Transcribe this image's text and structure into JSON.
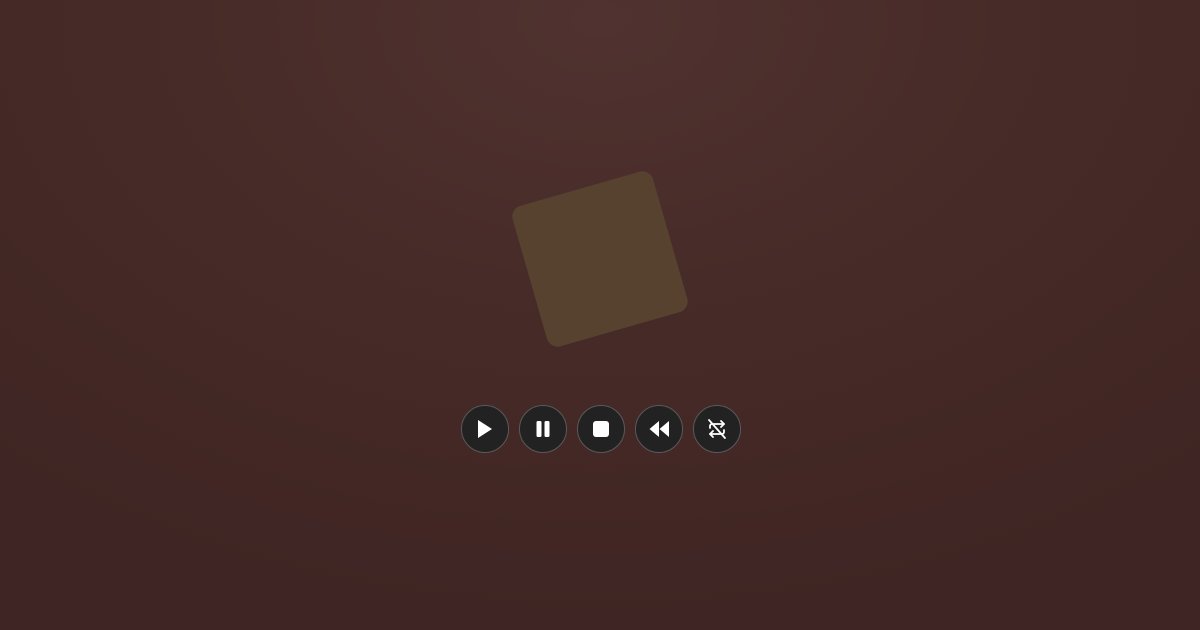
{
  "colors": {
    "tile": "#574230",
    "button_bg": "#222222",
    "button_border": "#5a5a5a",
    "icon": "#ffffff"
  },
  "controls": [
    {
      "action": "play",
      "icon": "play-icon"
    },
    {
      "action": "pause",
      "icon": "pause-icon"
    },
    {
      "action": "stop",
      "icon": "stop-icon"
    },
    {
      "action": "rewind",
      "icon": "rewind-icon"
    },
    {
      "action": "repeat",
      "icon": "repeat-icon"
    }
  ]
}
